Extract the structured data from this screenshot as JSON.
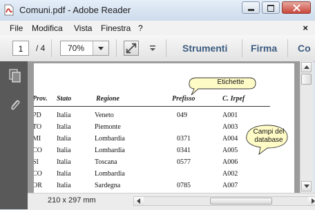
{
  "window": {
    "title": "Comuni.pdf - Adobe Reader"
  },
  "menu": {
    "items": [
      "File",
      "Modifica",
      "Vista",
      "Finestra",
      "?"
    ],
    "close_label": "×"
  },
  "toolbar": {
    "page_current": "1",
    "page_total": "/ 4",
    "zoom": "70%",
    "links": [
      "Strumenti",
      "Firma",
      "Co"
    ]
  },
  "document": {
    "columns": [
      "Prov.",
      "Stato",
      "Regione",
      "Prefisso",
      "C. Irpef"
    ],
    "rows": [
      [
        "PD",
        "Italia",
        "Veneto",
        "049",
        "A001"
      ],
      [
        "TO",
        "Italia",
        "Piemonte",
        "",
        "A003"
      ],
      [
        "MI",
        "Italia",
        "Lombardia",
        "0371",
        "A004"
      ],
      [
        "CO",
        "Italia",
        "Lombardia",
        "0341",
        "A005"
      ],
      [
        "SI",
        "Italia",
        "Toscana",
        "0577",
        "A006"
      ],
      [
        "CO",
        "Italia",
        "Lombardia",
        "",
        "A002"
      ],
      [
        "OR",
        "Italia",
        "Sardegna",
        "0785",
        "A007"
      ]
    ],
    "callouts": {
      "labels": "Etichette",
      "fields_line1": "Campi del",
      "fields_line2": "database"
    }
  },
  "status": {
    "page_size": "210 x 297 mm"
  },
  "colors": {
    "toolbar_link": "#3c5c80",
    "side_panel": "#595959",
    "viewer_bg": "#9b9b9b"
  },
  "icons": [
    "pdf-app-icon",
    "minimize-icon",
    "maximize-icon",
    "close-icon",
    "dropdown-arrow-icon",
    "fit-page-icon",
    "toolbar-options-icon",
    "pages-thumbnail-icon",
    "attachments-paperclip-icon",
    "scroll-up-icon",
    "scroll-down-icon",
    "scroll-left-icon",
    "scroll-right-icon"
  ]
}
